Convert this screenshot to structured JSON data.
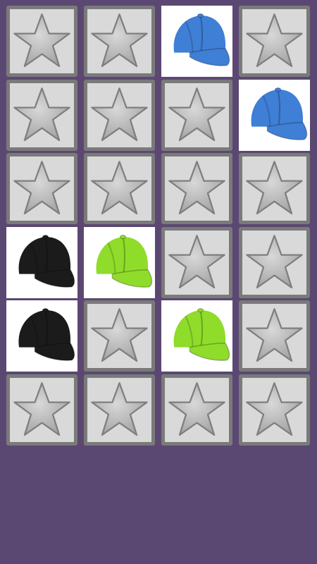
{
  "board": {
    "rows": 6,
    "columns": 4,
    "cards": [
      {
        "state": "hidden",
        "icon": "star-icon"
      },
      {
        "state": "hidden",
        "icon": "star-icon"
      },
      {
        "state": "revealed",
        "icon": "cap-icon",
        "color": "#3f7fd6"
      },
      {
        "state": "hidden",
        "icon": "star-icon"
      },
      {
        "state": "hidden",
        "icon": "star-icon"
      },
      {
        "state": "hidden",
        "icon": "star-icon"
      },
      {
        "state": "hidden",
        "icon": "star-icon"
      },
      {
        "state": "revealed",
        "icon": "cap-icon",
        "color": "#3f7fd6"
      },
      {
        "state": "hidden",
        "icon": "star-icon"
      },
      {
        "state": "hidden",
        "icon": "star-icon"
      },
      {
        "state": "hidden",
        "icon": "star-icon"
      },
      {
        "state": "hidden",
        "icon": "star-icon"
      },
      {
        "state": "revealed",
        "icon": "cap-icon",
        "color": "#1b1b1b"
      },
      {
        "state": "revealed",
        "icon": "cap-icon",
        "color": "#8fdc2a"
      },
      {
        "state": "hidden",
        "icon": "star-icon"
      },
      {
        "state": "hidden",
        "icon": "star-icon"
      },
      {
        "state": "revealed",
        "icon": "cap-icon",
        "color": "#1b1b1b"
      },
      {
        "state": "hidden",
        "icon": "star-icon"
      },
      {
        "state": "revealed",
        "icon": "cap-icon",
        "color": "#8fdc2a"
      },
      {
        "state": "hidden",
        "icon": "star-icon"
      },
      {
        "state": "hidden",
        "icon": "star-icon"
      },
      {
        "state": "hidden",
        "icon": "star-icon"
      },
      {
        "state": "hidden",
        "icon": "star-icon"
      },
      {
        "state": "hidden",
        "icon": "star-icon"
      }
    ]
  },
  "colors": {
    "background": "#5b4872",
    "card_face": "#d9d9d9",
    "card_border": "#7a7a7a",
    "star": "#a6a6a6"
  }
}
